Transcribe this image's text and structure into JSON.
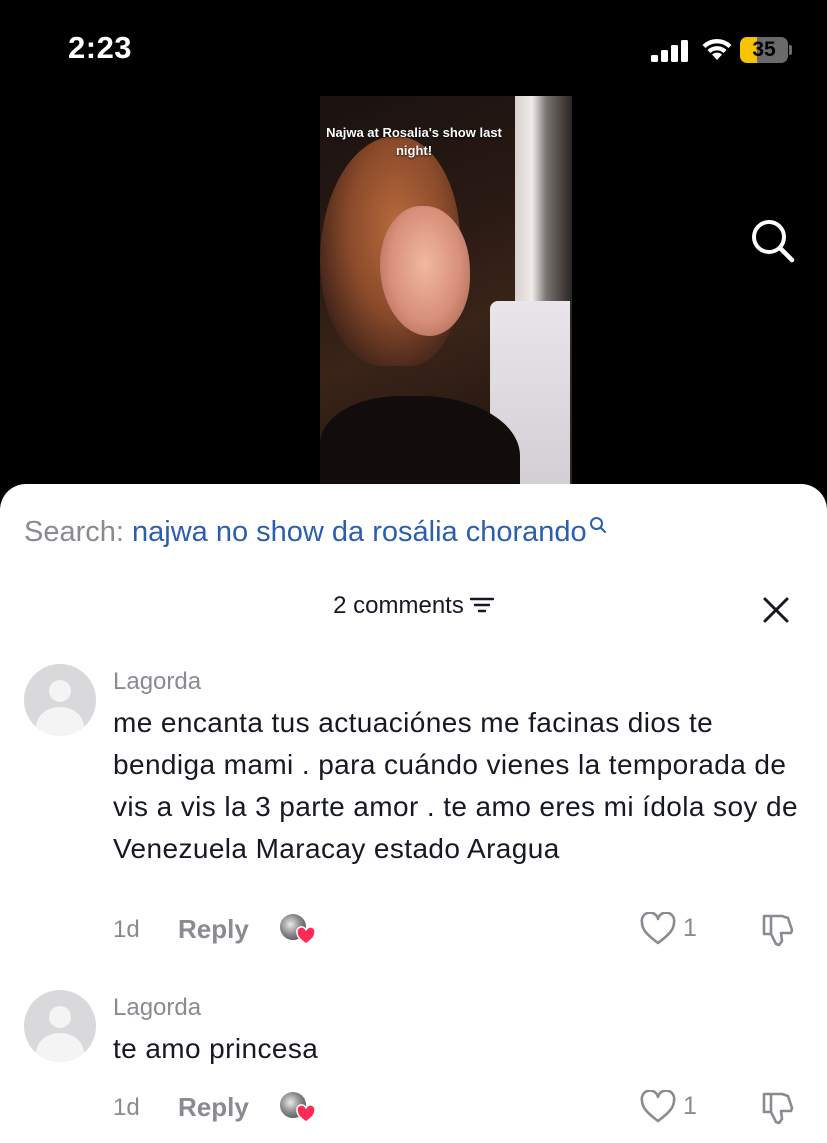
{
  "status_bar": {
    "time": "2:23",
    "battery": "35",
    "battery_level": 0.35
  },
  "video": {
    "caption": "Najwa at Rosalia's show last night!"
  },
  "search": {
    "label": "Search:",
    "query": "najwa no show da rosália chorando"
  },
  "comments_header": {
    "count_label": "2 comments"
  },
  "comments": [
    {
      "username": "Lagorda",
      "text": "me encanta tus actuaciónes me facinas dios te bendiga mami . para cuándo vienes la temporada de vis a vis la 3 parte amor . te amo eres mi ídola soy de Venezuela Maracay estado Aragua",
      "time": "1d",
      "reply_label": "Reply",
      "likes": "1"
    },
    {
      "username": "Lagorda",
      "text": "te amo princesa",
      "time": "1d",
      "reply_label": "Reply",
      "likes": "1"
    }
  ],
  "colors": {
    "accent_link": "#2b5db1",
    "muted": "#8a8b91",
    "heart": "#fe2c55",
    "battery": "#f5c400"
  }
}
